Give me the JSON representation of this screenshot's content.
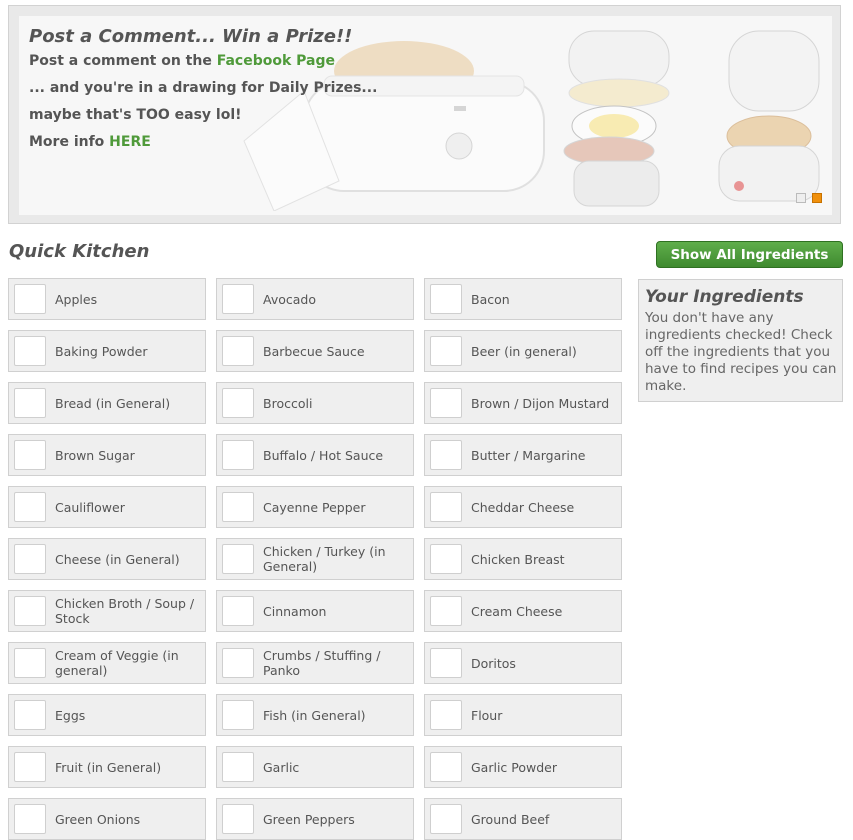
{
  "banner": {
    "title": "Post a Comment... Win a Prize!!",
    "line1_prefix": "Post a comment on the ",
    "line1_link": "Facebook Page",
    "line2": "... and you're in a drawing for Daily Prizes...",
    "line3": "maybe that's TOO easy lol!",
    "line4_prefix": "More info ",
    "line4_link": "HERE",
    "slide_count": 2,
    "active_slide": 2,
    "active_dot_color": "#f0900c"
  },
  "section_title": "Quick Kitchen",
  "show_all_label": "Show All Ingredients",
  "your_ingredients": {
    "title": "Your Ingredients",
    "message": "You don't have any ingredients checked! Check off the ingredients that you have to find recipes you can make."
  },
  "ingredients": [
    "Apples",
    "Avocado",
    "Bacon",
    "Baking Powder",
    "Barbecue Sauce",
    "Beer (in general)",
    "Bread (in General)",
    "Broccoli",
    "Brown / Dijon Mustard",
    "Brown Sugar",
    "Buffalo / Hot Sauce",
    "Butter / Margarine",
    "Cauliflower",
    "Cayenne Pepper",
    "Cheddar Cheese",
    "Cheese (in General)",
    "Chicken / Turkey (in General)",
    "Chicken Breast",
    "Chicken Broth / Soup / Stock",
    "Cinnamon",
    "Cream Cheese",
    "Cream of Veggie (in general)",
    "Crumbs / Stuffing / Panko",
    "Doritos",
    "Eggs",
    "Fish (in General)",
    "Flour",
    "Fruit (in General)",
    "Garlic",
    "Garlic Powder",
    "Green Onions",
    "Green Peppers",
    "Ground Beef"
  ],
  "colors": {
    "accent_green": "#4f9a3a",
    "button_green": "#4f9e3d"
  }
}
